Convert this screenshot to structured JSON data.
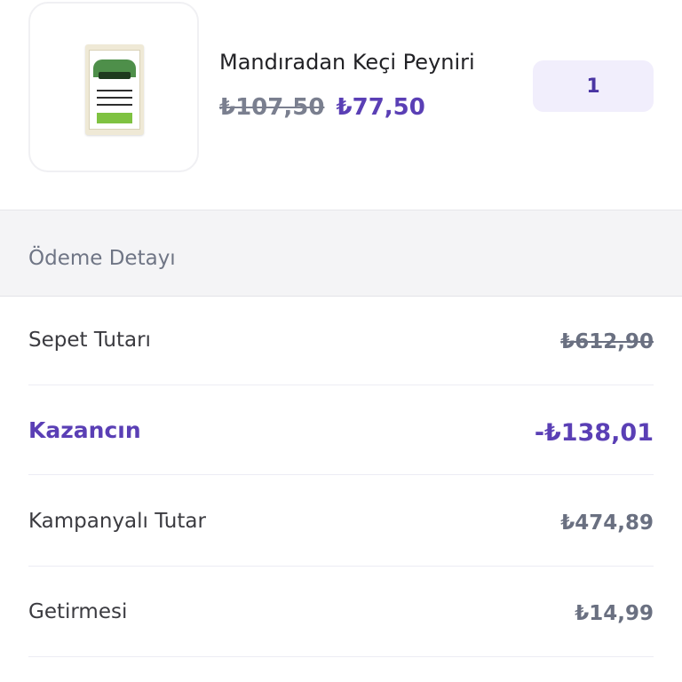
{
  "product": {
    "name": "Mandıradan Keçi Peyniri",
    "old_price": "₺107,50",
    "new_price": "₺77,50",
    "quantity": "1",
    "image_icon": "cheese-package-icon"
  },
  "payment_details": {
    "title": "Ödeme Detayı",
    "rows": [
      {
        "label": "Sepet Tutarı",
        "value": "₺612,90"
      },
      {
        "label": "Kazancın",
        "value": "-₺138,01"
      },
      {
        "label": "Kampanyalı Tutar",
        "value": "₺474,89"
      },
      {
        "label": "Getirmesi",
        "value": "₺14,99"
      }
    ]
  },
  "colors": {
    "accent": "#5a3fb5",
    "muted": "#6a7081",
    "quantity_bg": "#f1eefc",
    "section_bg": "#f4f4f6"
  }
}
